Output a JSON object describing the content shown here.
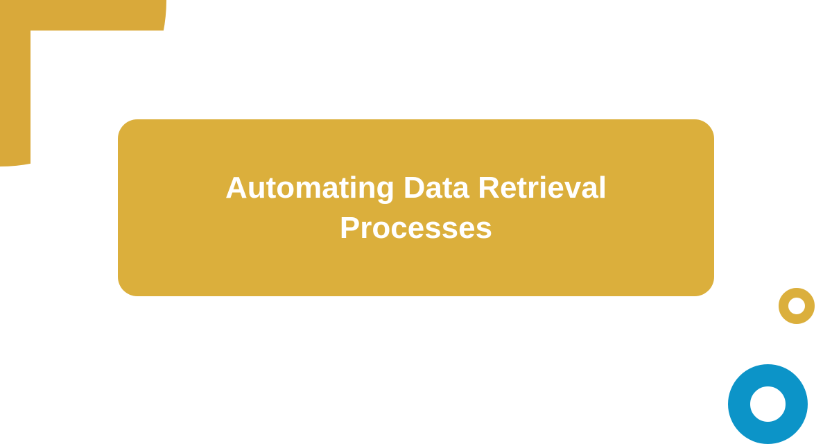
{
  "title": "Automating Data Retrieval Processes",
  "colors": {
    "gold": "#dbaf3c",
    "goldDark": "#d9a93a",
    "blue": "#0c94c8",
    "white": "#ffffff"
  }
}
